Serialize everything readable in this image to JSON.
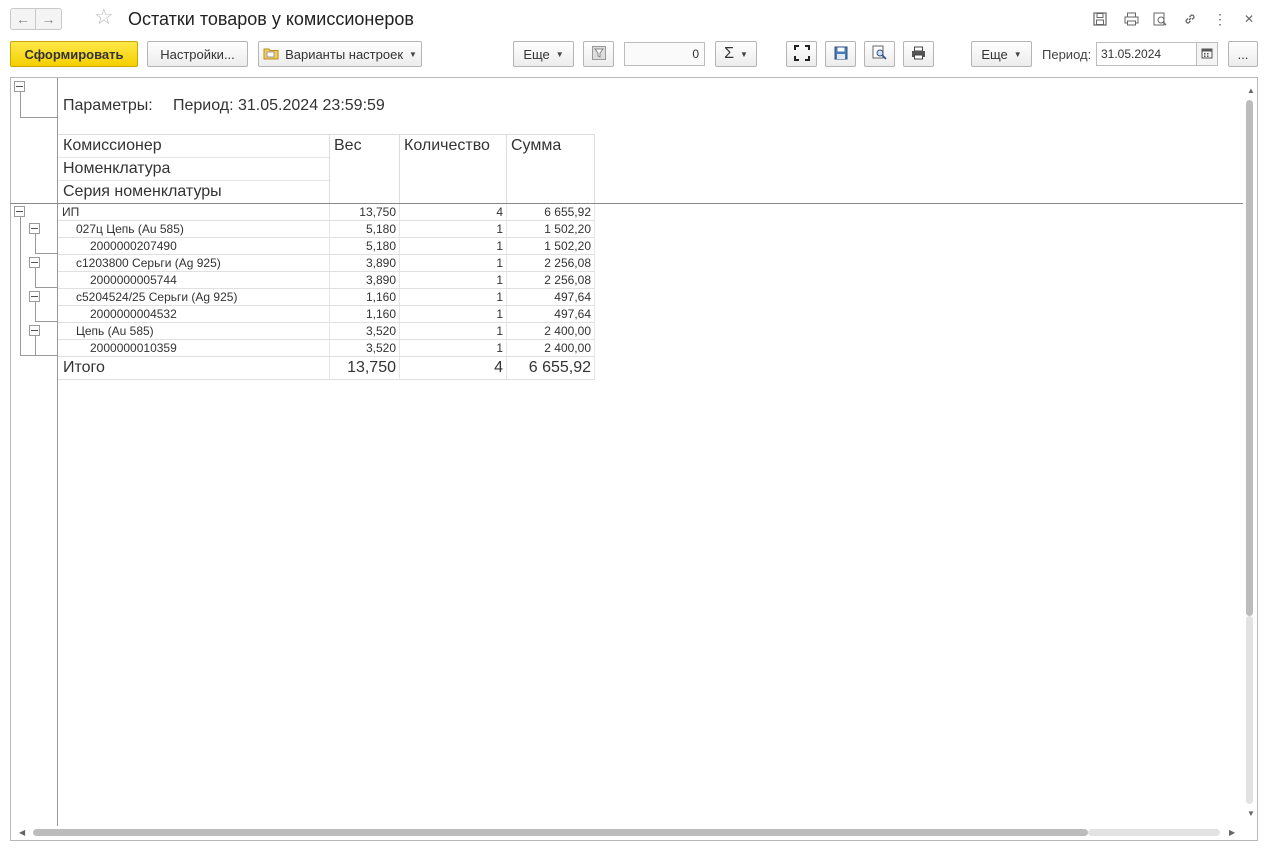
{
  "window": {
    "title": "Остатки товаров у комиссионеров"
  },
  "toolbar": {
    "generate_label": "Сформировать",
    "settings_label": "Настройки...",
    "variants_label": "Варианты настроек",
    "more_label": "Еще",
    "counter_value": "0",
    "sum_label": "Σ",
    "more2_label": "Еще",
    "period_label": "Период:",
    "period_value": "31.05.2024",
    "ellipsis_label": "..."
  },
  "report": {
    "params_label": "Параметры:",
    "params_value": "Период: 31.05.2024 23:59:59",
    "headers": {
      "group1": "Комиссионер",
      "group2": "Номенклатура",
      "group3": "Серия номенклатуры",
      "weight": "Вес",
      "qty": "Количество",
      "sum": "Сумма"
    },
    "rows": [
      {
        "name": "ИП",
        "weight": "13,750",
        "qty": "4",
        "sum": "6 655,92"
      },
      {
        "name": "027ц Цепь (Au 585)",
        "weight": "5,180",
        "qty": "1",
        "sum": "1 502,20"
      },
      {
        "name": "2000000207490",
        "weight": "5,180",
        "qty": "1",
        "sum": "1 502,20"
      },
      {
        "name": "с1203800 Серьги (Ag 925)",
        "weight": "3,890",
        "qty": "1",
        "sum": "2 256,08"
      },
      {
        "name": "2000000005744",
        "weight": "3,890",
        "qty": "1",
        "sum": "2 256,08"
      },
      {
        "name": "с5204524/25 Серьги (Ag 925)",
        "weight": "1,160",
        "qty": "1",
        "sum": "497,64"
      },
      {
        "name": "2000000004532",
        "weight": "1,160",
        "qty": "1",
        "sum": "497,64"
      },
      {
        "name": "Цепь (Au 585)",
        "weight": "3,520",
        "qty": "1",
        "sum": "2 400,00"
      },
      {
        "name": "2000000010359",
        "weight": "3,520",
        "qty": "1",
        "sum": "2 400,00"
      }
    ],
    "total": {
      "name": "Итого",
      "weight": "13,750",
      "qty": "4",
      "sum": "6 655,92"
    }
  }
}
